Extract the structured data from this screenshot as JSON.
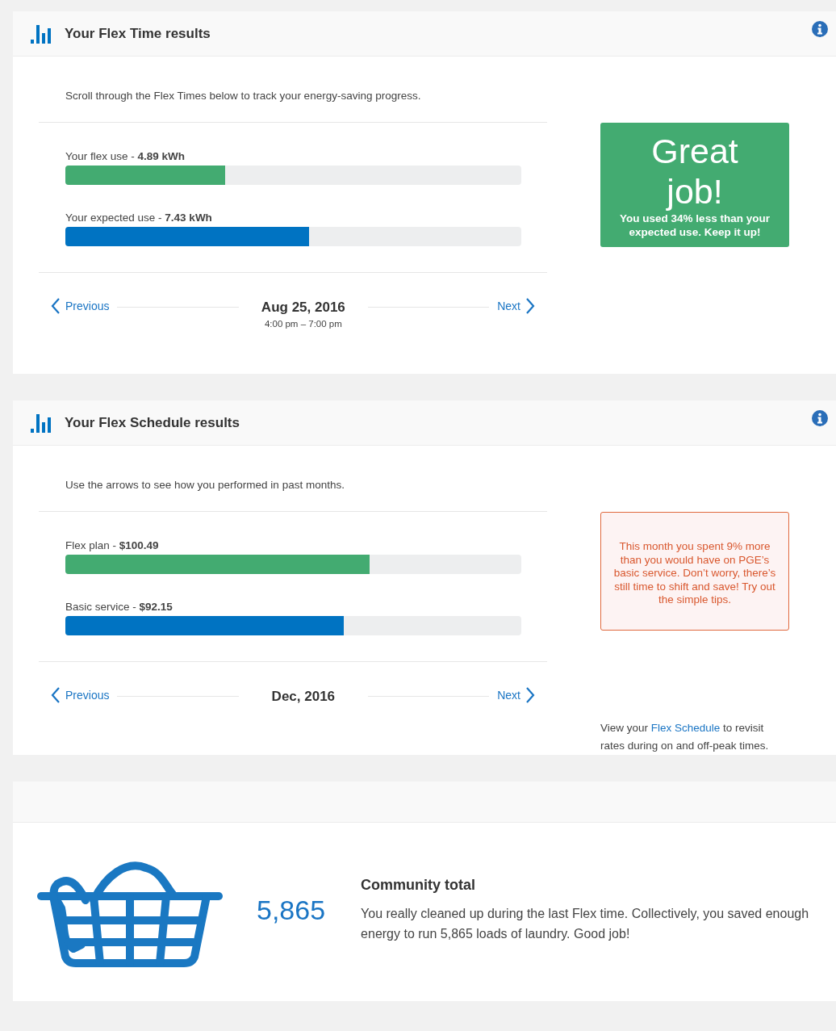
{
  "sections": [
    {
      "title": "Your Flex Time results",
      "intro": "Scroll through the Flex Times below to track your energy-saving progress.",
      "bars": [
        {
          "label": "Your flex use - **4.89 kWh**",
          "level": 0.35,
          "color": "#43ab71"
        },
        {
          "label": "Your expected use - **7.43 kWh**",
          "level": 0.535,
          "color": "#0073c2"
        }
      ],
      "nav": {
        "previous": "Previous",
        "next": "Next",
        "date": "Aug 25, 2016",
        "time": "4:00 pm – 7:00 pm"
      },
      "message": {
        "kind": "success",
        "headline": "Great job!",
        "text": "You used 34% less than your expected use. Keep it up!"
      }
    },
    {
      "title": "Your Flex Schedule results",
      "intro": "Use the arrows to see how you performed in past months.",
      "bars": [
        {
          "label": "Flex plan - **$100.49**",
          "level": 0.667,
          "color": "#43ab71"
        },
        {
          "label": "Basic service - **$92.15**",
          "level": 0.61,
          "color": "#0073c2"
        }
      ],
      "nav": {
        "previous": "Previous",
        "next": "Next",
        "date": "Dec, 2016"
      },
      "message": {
        "kind": "warning",
        "text": "This month you spent 9% more than you would have on PGE’s basic service. Don’t worry, there’s still time to shift and save! Try out the simple tips."
      },
      "note": {
        "before": "View your ",
        "link": "Flex Schedule",
        "after": " to revisit rates during on and off-peak times."
      }
    }
  ],
  "community": {
    "count": "5,865",
    "title": "Community total",
    "text": "You really cleaned up during the last Flex time. Collectively, you saved enough energy to run 5,865 loads of laundry. Good job!"
  }
}
